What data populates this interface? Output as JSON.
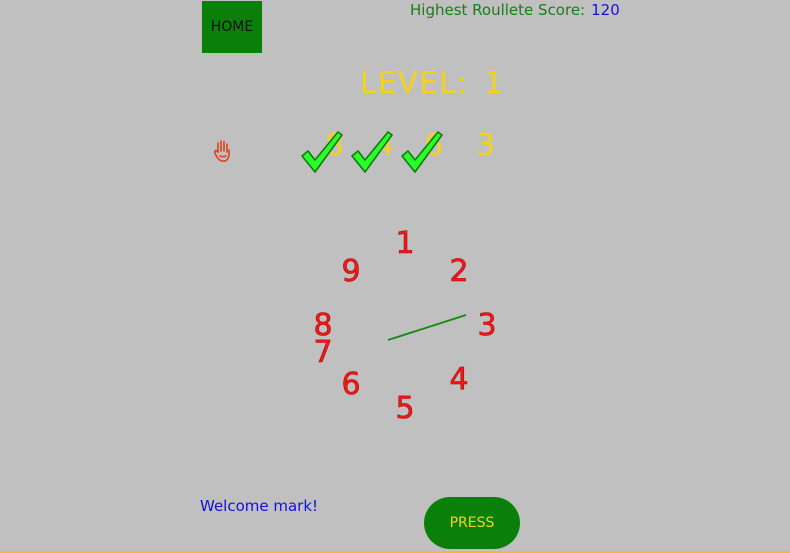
{
  "home_button": {
    "label": "HOME"
  },
  "score": {
    "label": "Highest Roullete Score:",
    "value": "120"
  },
  "level": {
    "label": "LEVEL:",
    "value": "1"
  },
  "sequence": [
    {
      "value": "8",
      "checked": true
    },
    {
      "value": "4",
      "checked": true
    },
    {
      "value": "6",
      "checked": true
    },
    {
      "value": "3",
      "checked": false
    }
  ],
  "dial": {
    "numbers": [
      "1",
      "2",
      "3",
      "4",
      "5",
      "6",
      "7",
      "8",
      "9"
    ]
  },
  "welcome": "Welcome  mark!",
  "press_button": {
    "label": "PRESS"
  },
  "colors": {
    "background": "#c0c0c0",
    "button_green": "#0a7f0a",
    "level_yellow": "#f2d31b",
    "dial_red": "#ea1c1c",
    "score_value_blue": "#1515d8",
    "welcome_blue": "#1212d6",
    "check_green": "#2aff2a",
    "pointer_green": "#128a12"
  },
  "icons": {
    "hand": "hand-icon",
    "check": "check-icon"
  }
}
